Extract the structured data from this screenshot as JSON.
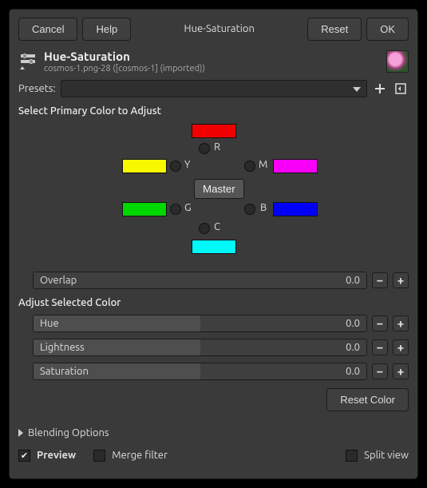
{
  "header": {
    "cancel": "Cancel",
    "help": "Help",
    "title_short": "Hue-Saturation",
    "reset": "Reset",
    "ok": "OK"
  },
  "title": {
    "name": "Hue-Saturation",
    "file": "cosmos-1.png-28 ([cosmos-1] (imported))"
  },
  "presets": {
    "label": "Presets:"
  },
  "select_primary": "Select Primary Color to Adjust",
  "channels": {
    "R": "R",
    "Y": "Y",
    "G": "G",
    "C": "C",
    "B": "B",
    "M": "M",
    "master": "Master"
  },
  "colors": {
    "R": "#f00000",
    "Y": "#f8f800",
    "G": "#00d800",
    "C": "#00f8f8",
    "B": "#0000f8",
    "M": "#f800f8"
  },
  "sliders": {
    "overlap": {
      "label": "Overlap",
      "value": "0.0"
    },
    "hue": {
      "label": "Hue",
      "value": "0.0"
    },
    "lightness": {
      "label": "Lightness",
      "value": "0.0"
    },
    "saturation": {
      "label": "Saturation",
      "value": "0.0"
    }
  },
  "adjust_label": "Adjust Selected Color",
  "reset_color": "Reset Color",
  "blending": "Blending Options",
  "footer": {
    "preview": "Preview",
    "merge": "Merge filter",
    "split": "Split view"
  }
}
